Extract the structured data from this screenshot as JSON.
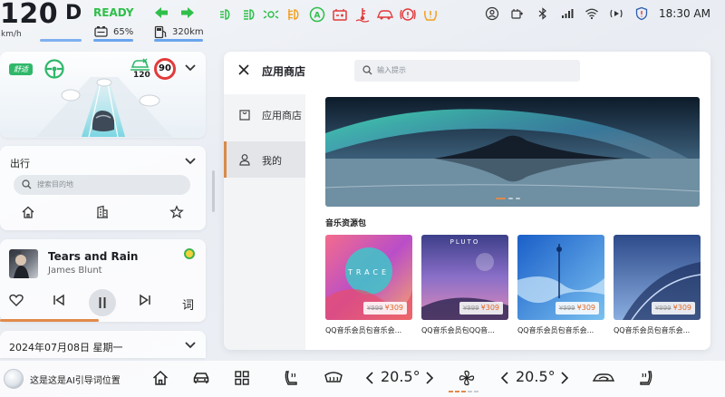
{
  "status": {
    "speed": "120",
    "speed_unit": "km/h",
    "gear": "D",
    "ready": "READY",
    "battery": "65%",
    "range": "320km",
    "time": "18:30 AM",
    "colors": {
      "ready": "#2fbf4a",
      "indicator": "#2fbf4a",
      "warning": "#e23b3b",
      "amber": "#f0a020"
    },
    "telltales": [
      "parking-light-icon",
      "headlight-icon",
      "low-beam-icon",
      "fog-light-icon",
      "auto-hold-icon",
      "battery-warning-icon",
      "coolant-icon",
      "car-alert-icon",
      "brake-warning-icon",
      "tire-pressure-icon"
    ],
    "system_icons": [
      "user-icon",
      "cruise-icon",
      "bluetooth-icon",
      "signal-icon",
      "wifi-icon",
      "media-icon",
      "shield-icon"
    ]
  },
  "drive": {
    "mode_chip": "舒适",
    "set_speed": "120",
    "speed_limit": "90"
  },
  "trip": {
    "title": "出行",
    "search_placeholder": "搜索目的地",
    "shortcuts": [
      "home-icon",
      "company-icon",
      "favorite-icon"
    ]
  },
  "music": {
    "song": "Tears and Rain",
    "artist": "James Blunt",
    "lyrics_label": "词",
    "progress": 0.48
  },
  "date": {
    "text": "2024年07月08日 星期一"
  },
  "store": {
    "title": "应用商店",
    "search_placeholder": "输入提示",
    "nav": [
      {
        "label": "应用商店",
        "icon": "bag-icon"
      },
      {
        "label": "我的",
        "icon": "person-icon"
      }
    ],
    "banner_pages": 3,
    "section_title": "音乐资源包",
    "items": [
      {
        "caption": "QQ音乐会员包音乐会...",
        "old_price": "¥999",
        "price": "¥309",
        "art_text": "TRACE"
      },
      {
        "caption": "QQ音乐会员包QQ音...",
        "old_price": "¥999",
        "price": "¥309",
        "art_text": "PLUTO"
      },
      {
        "caption": "QQ音乐会员包音乐会...",
        "old_price": "¥999",
        "price": "¥309",
        "art_text": ""
      },
      {
        "caption": "QQ音乐会员包音乐会...",
        "old_price": "¥999",
        "price": "¥309",
        "art_text": ""
      }
    ]
  },
  "dock": {
    "ai_hint": "这是这是AI引导词位置",
    "temp_left": "20.5°",
    "temp_right": "20.5°",
    "fan_level": 3,
    "fan_levels_total": 5
  }
}
